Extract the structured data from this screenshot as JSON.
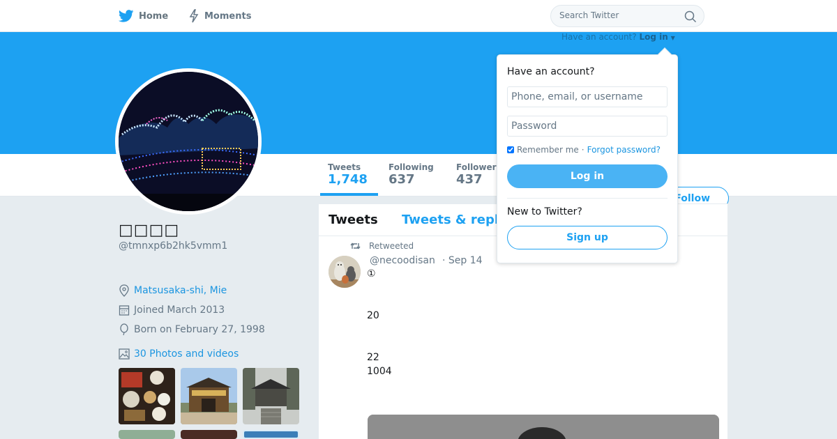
{
  "nav": {
    "home_label": "Home",
    "moments_label": "Moments",
    "search_placeholder": "Search Twitter"
  },
  "login_prompt": {
    "label": "Have an account?",
    "link": "Log in"
  },
  "profile": {
    "name": "□□□□",
    "handle": "@tmnxp6b2hk5vmm1",
    "location": "Matsusaka-shi, Mie",
    "joined": "Joined March 2013",
    "born": "Born on February 27, 1998",
    "photos_link": "30 Photos and videos"
  },
  "stats": [
    {
      "label": "Tweets",
      "value": "1,748"
    },
    {
      "label": "Following",
      "value": "637"
    },
    {
      "label": "Followers",
      "value": "437"
    }
  ],
  "follow_label": "Follow",
  "timeline": {
    "tab_tweets": "Tweets",
    "tab_replies": "Tweets & replies"
  },
  "tweet": {
    "retweet_context": "Retweeted",
    "username": "@necoodisan",
    "date": "· Sep 14",
    "lines": [
      "①",
      "20",
      "22",
      "1004"
    ]
  },
  "login_dropdown": {
    "title": "Have an account?",
    "username_placeholder": "Phone, email, or username",
    "password_placeholder": "Password",
    "remember_label": "Remember me",
    "separator": "·",
    "forgot_label": "Forgot password?",
    "login_button": "Log in",
    "new_label": "New to Twitter?",
    "signup_button": "Sign up"
  },
  "colors": {
    "brand": "#1da1f2",
    "link": "#1b95e0",
    "background": "#e6ecf0"
  }
}
